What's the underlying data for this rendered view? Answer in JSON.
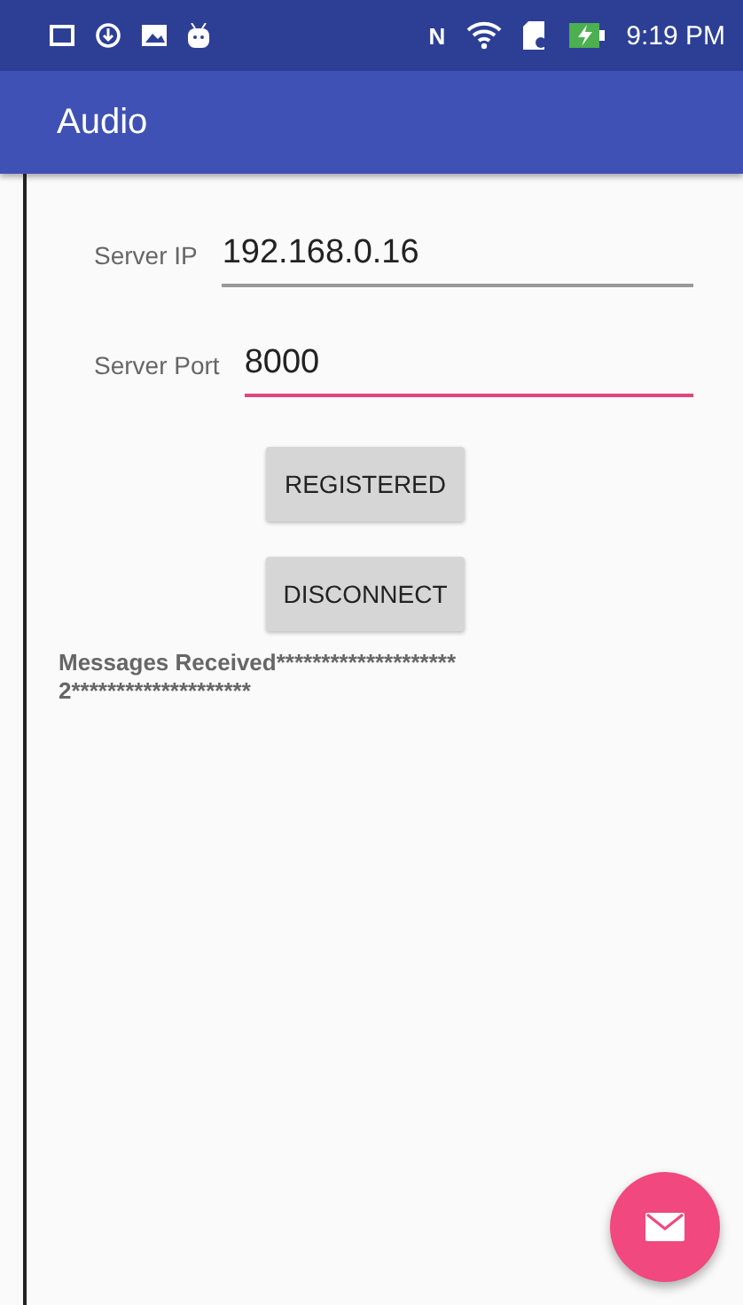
{
  "status_bar": {
    "time": "9:19 PM",
    "nfc": "N"
  },
  "app_bar": {
    "title": "Audio"
  },
  "fields": [
    {
      "label": "Server IP",
      "value": "192.168.0.16",
      "focused": false
    },
    {
      "label": "Server Port",
      "value": "8000",
      "focused": true
    }
  ],
  "buttons": [
    "REGISTERED",
    "DISCONNECT"
  ],
  "messages": "Messages Received********************\n2********************"
}
